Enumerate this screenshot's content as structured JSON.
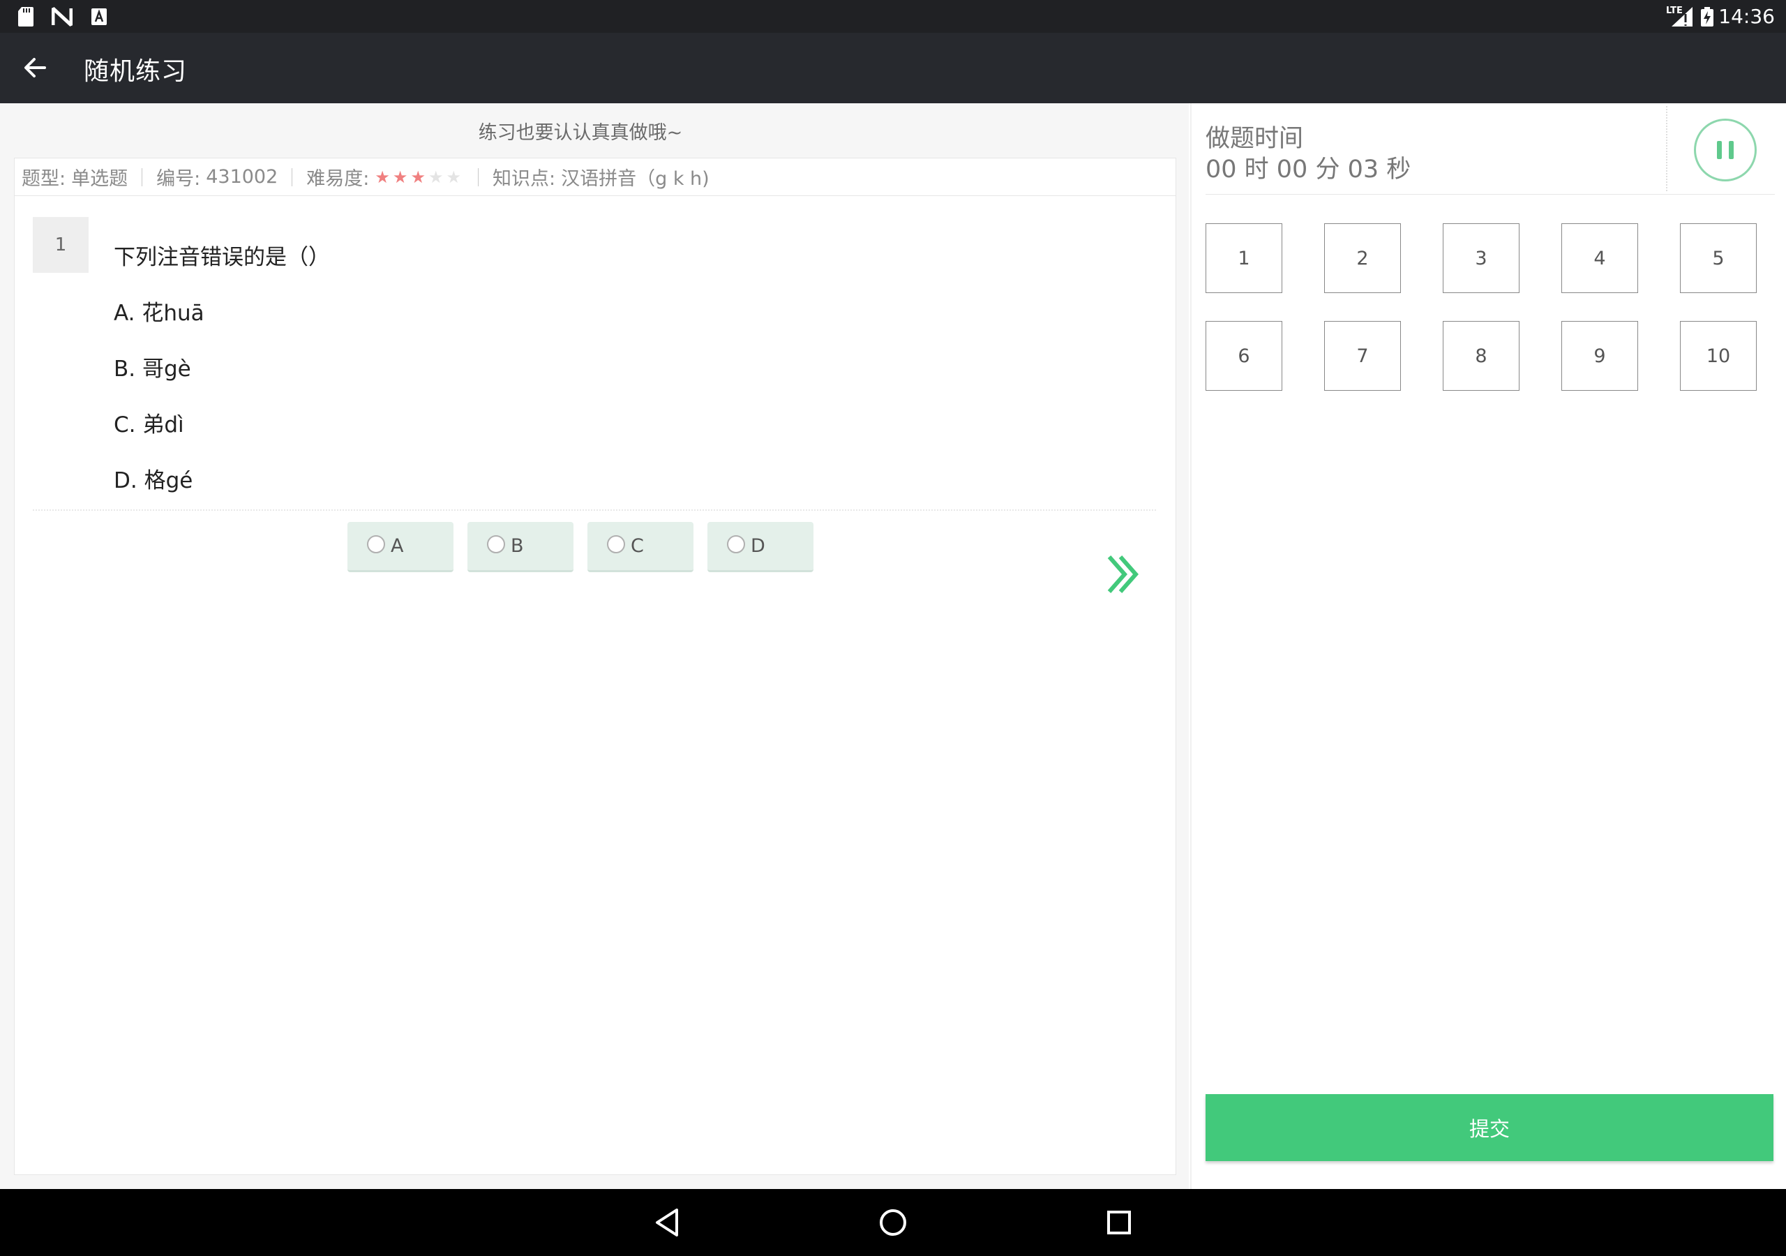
{
  "status_bar": {
    "time": "14:36",
    "network": "LTE"
  },
  "app_bar": {
    "title": "随机练习"
  },
  "question_panel": {
    "tip": "练习也要认认真真做哦~",
    "meta": {
      "type_label": "题型:",
      "type_value": "单选题",
      "id_label": "编号:",
      "id_value": "431002",
      "difficulty_label": "难易度:",
      "difficulty_stars": 3,
      "difficulty_max": 5,
      "knowledge_label": "知识点:",
      "knowledge_value": "汉语拼音（g k h)"
    },
    "question": {
      "number": "1",
      "text": "下列注音错误的是（）",
      "options": [
        "A. 花huā",
        "B. 哥gè",
        "C. 弟dì",
        "D. 格gé"
      ]
    },
    "answer_buttons": [
      "A",
      "B",
      "C",
      "D"
    ]
  },
  "side_panel": {
    "timer_label": "做题时间",
    "timer_value": "00 时 00 分 03 秒",
    "question_numbers": [
      "1",
      "2",
      "3",
      "4",
      "5",
      "6",
      "7",
      "8",
      "9",
      "10"
    ],
    "submit_label": "提交"
  },
  "colors": {
    "accent": "#42c97b",
    "answer_bg": "#e4f0ea",
    "app_bar": "#27292e",
    "star_on": "#f08080",
    "star_off": "#e4e4e4"
  }
}
